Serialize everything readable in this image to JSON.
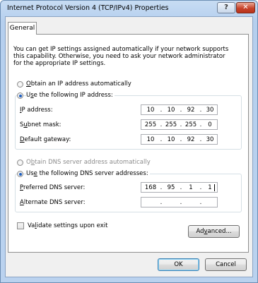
{
  "window": {
    "title": "Internet Protocol Version 4 (TCP/IPv4) Properties",
    "help_glyph": "?",
    "close_glyph": "✕"
  },
  "tabs": [
    "General"
  ],
  "description": "You can get IP settings assigned automatically if your network supports\nthis capability. Otherwise, you need to ask your network administrator\nfor the appropriate IP settings.",
  "ip_section": {
    "auto_label": "Obtain an IP address automatically",
    "auto_mnemonic": "O",
    "auto_rest": "btain an IP address automatically",
    "manual_pre": "U",
    "manual_mnemonic": "s",
    "manual_rest": "e the following IP address:",
    "selected": "manual",
    "fields": [
      {
        "pre": "",
        "mnemonic": "I",
        "rest": "P address:",
        "octets": [
          "10",
          "10",
          "92",
          "30"
        ]
      },
      {
        "pre": "S",
        "mnemonic": "u",
        "rest": "bnet mask:",
        "octets": [
          "255",
          "255",
          "255",
          "0"
        ]
      },
      {
        "pre": "",
        "mnemonic": "D",
        "rest": "efault gateway:",
        "octets": [
          "10",
          "10",
          "92",
          "30"
        ]
      }
    ]
  },
  "dns_section": {
    "auto_pre": "O",
    "auto_mnemonic": "b",
    "auto_rest": "tain DNS server address automatically",
    "manual_pre": "Us",
    "manual_mnemonic": "e",
    "manual_rest": " the following DNS server addresses:",
    "selected": "manual",
    "fields": [
      {
        "pre": "",
        "mnemonic": "P",
        "rest": "referred DNS server:",
        "octets": [
          "168",
          "95",
          "1",
          "1"
        ]
      },
      {
        "pre": "",
        "mnemonic": "A",
        "rest": "lternate DNS server:",
        "octets": [
          "",
          "",
          "",
          ""
        ]
      }
    ]
  },
  "validate": {
    "pre": "Va",
    "mnemonic": "l",
    "rest": "idate settings upon exit",
    "checked": false
  },
  "buttons": {
    "advanced_pre": "Ad",
    "advanced_mnemonic": "v",
    "advanced_rest": "anced...",
    "ok": "OK",
    "cancel": "Cancel"
  }
}
